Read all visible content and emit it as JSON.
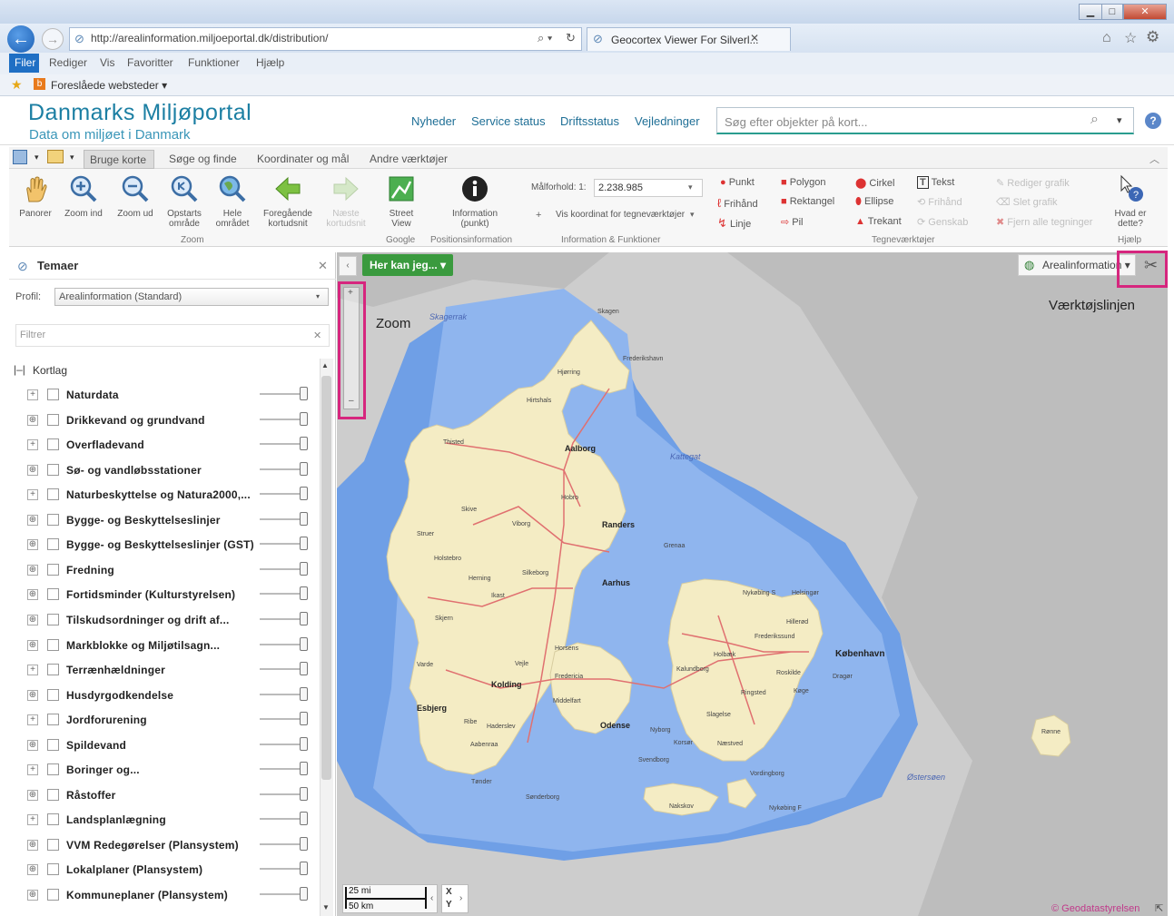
{
  "browser": {
    "address": "http://arealinformation.miljoeportal.dk/distribution/",
    "tab_title": "Geocortex Viewer For Silverl...",
    "menu": [
      "Filer",
      "Rediger",
      "Vis",
      "Favoritter",
      "Funktioner",
      "Hjælp"
    ],
    "favorites_label": "Foreslåede websteder ▾"
  },
  "portal": {
    "title": "Danmarks Miljøportal",
    "subtitle": "Data om miljøet i Danmark",
    "nav": [
      "Nyheder",
      "Service status",
      "Driftsstatus",
      "Vejledninger"
    ],
    "search_placeholder": "Søg efter objekter på kort..."
  },
  "ribbon": {
    "tabs": [
      "Bruge korte",
      "Søge og finde",
      "Koordinater og mål",
      "Andre værktøjer"
    ],
    "buttons": [
      {
        "label": "Panorer"
      },
      {
        "label": "Zoom ind"
      },
      {
        "label": "Zoom ud"
      },
      {
        "label": "Opstarts område"
      },
      {
        "label": "Hele området"
      },
      {
        "label": "Foregående kortudsnit"
      },
      {
        "label": "Næste kortudsnit"
      },
      {
        "label": "Street View"
      },
      {
        "label": "Information (punkt)"
      }
    ],
    "groups": {
      "zoom": "Zoom",
      "google": "Google",
      "position": "Positionsinformation",
      "info": "Information & Funktioner",
      "draw": "Tegneværktøjer",
      "help": "Hjælp"
    },
    "scale_label": "Målforhold: 1:",
    "scale_value": "2.238.985",
    "coord_label": "Vis koordinat for tegneværktøjer",
    "draw_tools": [
      "Punkt",
      "Frihånd",
      "Linje",
      "Polygon",
      "Rektangel",
      "Pil",
      "Cirkel",
      "Ellipse",
      "Trekant",
      "Tekst",
      "Frihånd",
      "Genskab"
    ],
    "edit_tools": [
      "Rediger grafik",
      "Slet grafik",
      "Fjern alle tegninger"
    ],
    "help_label": "Hvad er dette?"
  },
  "panel": {
    "title": "Temaer",
    "profile_label": "Profil:",
    "profile_value": "Arealinformation (Standard)",
    "filter_placeholder": "Filtrer",
    "root": "Kortlag",
    "layers": [
      "Naturdata",
      "Drikkevand og grundvand",
      "Overfladevand",
      "Sø- og vandløbsstationer",
      "Naturbeskyttelse og Natura2000,...",
      "Bygge- og Beskyttelseslinjer",
      "Bygge- og Beskyttelseslinjer (GST)",
      "Fredning",
      "Fortidsminder (Kulturstyrelsen)",
      "Tilskudsordninger og drift af...",
      "Markblokke og Miljøtilsagn...",
      "Terrænhældninger",
      "Husdyrgodkendelse",
      "Jordforurening",
      "Spildevand",
      "Boringer og...",
      "Råstoffer",
      "Landsplanlægning",
      "VVM Redegørelser (Plansystem)",
      "Lokalplaner (Plansystem)",
      "Kommuneplaner (Plansystem)"
    ]
  },
  "map": {
    "her_kan_jeg": "Her kan jeg... ▾",
    "layer_switch": "Arealinformation ▾",
    "annotation_zoom": "Zoom",
    "annotation_toolbar": "Værktøjslinjen",
    "scale_mi": "25 mi",
    "scale_km": "50 km",
    "coord_x": "X",
    "coord_y": "Y",
    "copyright": "© Geodatastyrelsen",
    "places": {
      "skagerrak": "Skagerrak",
      "kattegat": "Kattegat",
      "ostersoen": "Østersøen",
      "aalborg": "Aalborg",
      "randers": "Randers",
      "aarhus": "Aarhus",
      "kolding": "Kolding",
      "esbjerg": "Esbjerg",
      "odense": "Odense",
      "kobenhavn": "København",
      "skagen": "Skagen",
      "frederikshavn": "Frederikshavn",
      "hjorring": "Hjørring",
      "hirtshals": "Hirtshals",
      "thisted": "Thisted",
      "viborg": "Viborg",
      "herning": "Herning",
      "holstebro": "Holstebro",
      "silkeborg": "Silkeborg",
      "vejle": "Vejle",
      "fredericia": "Fredericia",
      "horsens": "Horsens",
      "struer": "Struer",
      "skive": "Skive",
      "grenaa": "Grenaa",
      "roskilde": "Roskilde",
      "holbaek": "Holbæk",
      "kalundborg": "Kalundborg",
      "slagelse": "Slagelse",
      "naestved": "Næstved",
      "ringsted": "Ringsted",
      "koge": "Køge",
      "helsingor": "Helsingør",
      "hillerod": "Hillerød",
      "dragor": "Dragør",
      "nyborg": "Nyborg",
      "svendborg": "Svendborg",
      "vordingborg": "Vordingborg",
      "nakskov": "Nakskov",
      "nykobing": "Nykøbing F",
      "ronne": "Rønne",
      "aabenraa": "Aabenraa",
      "sonderborg": "Sønderborg",
      "tonder": "Tønder",
      "ribe": "Ribe",
      "varde": "Varde",
      "skjern": "Skjern",
      "ikast": "Ikast",
      "hobro": "Hobro",
      "nykobing_s": "Nykøbing S",
      "haderslev": "Haderslev",
      "middelfart": "Middelfart",
      "korsor": "Korsør",
      "frederikssund": "Frederikssund"
    }
  }
}
